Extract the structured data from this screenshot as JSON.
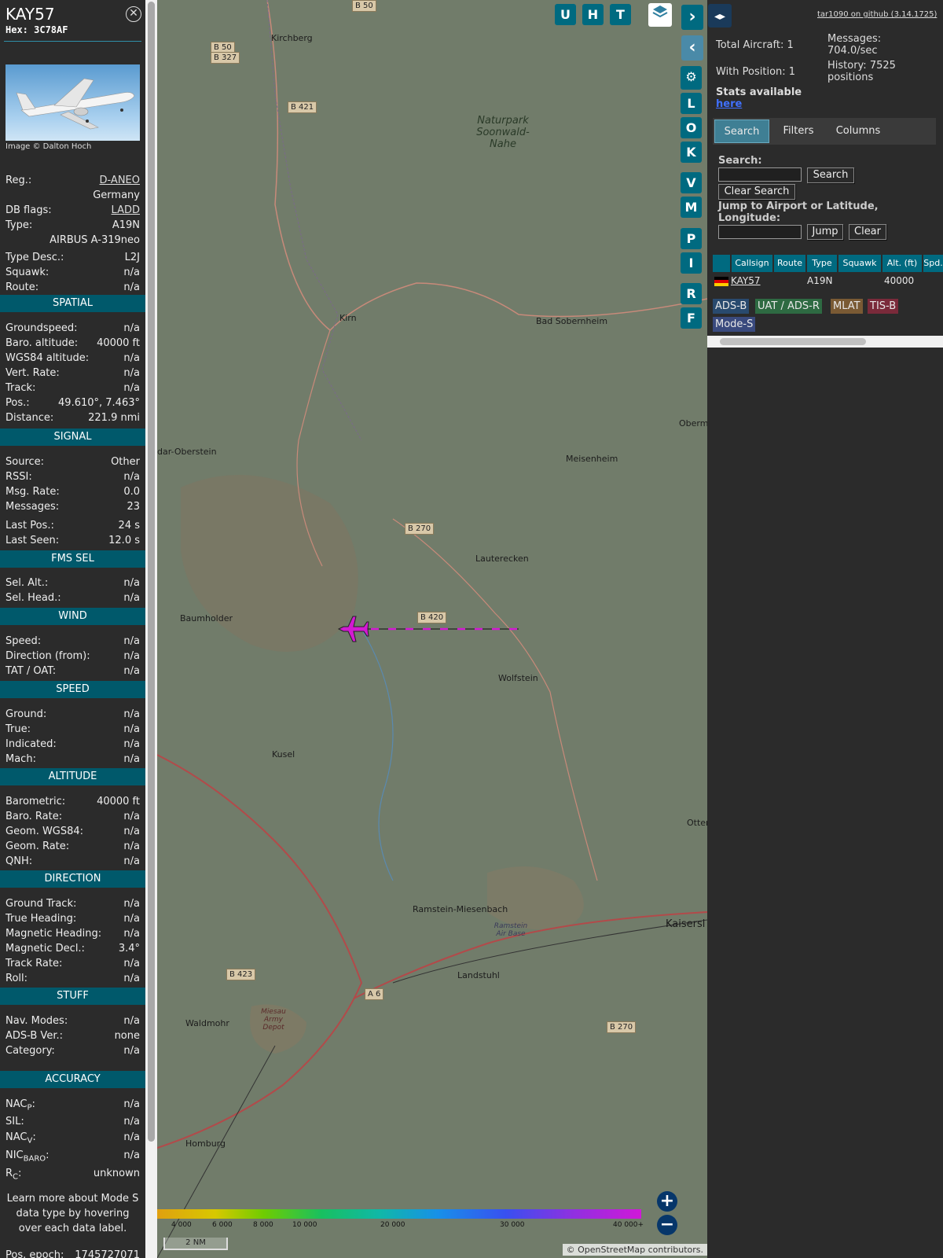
{
  "header": {
    "callsign": "KAY57",
    "hex": "Hex: 3C78AF",
    "photo_credit": "Image © Dalton Hoch"
  },
  "aircraft": [
    {
      "label": "Reg.:",
      "value": "D-ANEO",
      "link": true
    },
    {
      "label": "",
      "value": "Germany"
    },
    {
      "label": "DB flags:",
      "value": "LADD",
      "link": true
    },
    {
      "label": "Type:",
      "value": "A19N"
    },
    {
      "label": "",
      "value": "AIRBUS A-319neo"
    },
    {
      "label": "Type Desc.:",
      "value": "L2J"
    },
    {
      "label": "Squawk:",
      "value": "n/a"
    },
    {
      "label": "Route:",
      "value": "n/a"
    }
  ],
  "sections": {
    "spatial": "SPATIAL",
    "signal": "SIGNAL",
    "fms": "FMS SEL",
    "wind": "WIND",
    "speed": "SPEED",
    "altitude": "ALTITUDE",
    "direction": "DIRECTION",
    "stuff": "STUFF",
    "accuracy": "ACCURACY"
  },
  "spatial": [
    {
      "label": "Groundspeed:",
      "value": "n/a"
    },
    {
      "label": "Baro. altitude:",
      "value": "40000 ft"
    },
    {
      "label": "WGS84 altitude:",
      "value": "n/a"
    },
    {
      "label": "Vert. Rate:",
      "value": "n/a"
    },
    {
      "label": "Track:",
      "value": "n/a"
    },
    {
      "label": "Pos.:",
      "value": "49.610°, 7.463°"
    },
    {
      "label": "Distance:",
      "value": "221.9 nmi"
    }
  ],
  "signal": [
    {
      "label": "Source:",
      "value": "Other"
    },
    {
      "label": "RSSI:",
      "value": "n/a"
    },
    {
      "label": "Msg. Rate:",
      "value": "0.0"
    },
    {
      "label": "Messages:",
      "value": "23"
    },
    {
      "label": "Last Pos.:",
      "value": "24 s"
    },
    {
      "label": "Last Seen:",
      "value": "12.0 s"
    }
  ],
  "fms": [
    {
      "label": "Sel. Alt.:",
      "value": "n/a"
    },
    {
      "label": "Sel. Head.:",
      "value": "n/a"
    }
  ],
  "wind": [
    {
      "label": "Speed:",
      "value": "n/a"
    },
    {
      "label": "Direction (from):",
      "value": "n/a"
    },
    {
      "label": "TAT / OAT:",
      "value": "n/a"
    }
  ],
  "speed": [
    {
      "label": "Ground:",
      "value": "n/a"
    },
    {
      "label": "True:",
      "value": "n/a"
    },
    {
      "label": "Indicated:",
      "value": "n/a"
    },
    {
      "label": "Mach:",
      "value": "n/a"
    }
  ],
  "altitude": [
    {
      "label": "Barometric:",
      "value": "40000 ft"
    },
    {
      "label": "Baro. Rate:",
      "value": "n/a"
    },
    {
      "label": "Geom. WGS84:",
      "value": "n/a"
    },
    {
      "label": "Geom. Rate:",
      "value": "n/a"
    },
    {
      "label": "QNH:",
      "value": "n/a"
    }
  ],
  "direction": [
    {
      "label": "Ground Track:",
      "value": "n/a"
    },
    {
      "label": "True Heading:",
      "value": "n/a"
    },
    {
      "label": "Magnetic Heading:",
      "value": "n/a"
    },
    {
      "label": "Magnetic Decl.:",
      "value": "3.4°"
    },
    {
      "label": "Track Rate:",
      "value": "n/a"
    },
    {
      "label": "Roll:",
      "value": "n/a"
    }
  ],
  "stuff": [
    {
      "label": "Nav. Modes:",
      "value": "n/a"
    },
    {
      "label": "ADS-B Ver.:",
      "value": "none"
    },
    {
      "label": "Category:",
      "value": "n/a"
    }
  ],
  "accuracy": [
    {
      "label": "NAC",
      "sub": "P",
      "value": "n/a"
    },
    {
      "label": "SIL:",
      "sub": "",
      "value": "n/a"
    },
    {
      "label": "NAC",
      "sub": "V",
      "value": "n/a"
    },
    {
      "label": "NIC",
      "sub": "BARO",
      "value": "n/a"
    },
    {
      "label": "R",
      "sub": "C",
      "value": "unknown"
    }
  ],
  "note": "Learn more about Mode S data type by hovering over each data label.",
  "pos_epoch": {
    "label": "Pos. epoch:",
    "value": "1745727071"
  },
  "map": {
    "toolbar_top": [
      "U",
      "H",
      "T"
    ],
    "toolbar_side": [
      "L",
      "O",
      "K",
      "V",
      "M",
      "P",
      "I",
      "R",
      "F"
    ],
    "places": [
      "Kirchberg",
      "Kirn",
      "Bad Sobernheim",
      "dar-Oberstein",
      "Meisenheim",
      "Oberm",
      "Lauterecken",
      "Baumholder",
      "Wolfstein",
      "Kusel",
      "Otter",
      "Ramstein-Miesenbach",
      "Kaisersl",
      "Landstuhl",
      "Waldmohr",
      "Homburg"
    ],
    "park": "Naturpark Soonwald-Nahe",
    "airbase": "Ramstein Air Base",
    "depot": "Miesau Army Depot",
    "roads": [
      "B 50",
      "B 50",
      "B 327",
      "B 421",
      "B 270",
      "B 420",
      "A 6",
      "B 423",
      "B 270"
    ],
    "color_ticks": [
      "4 000",
      "6 000",
      "8 000",
      "10 000",
      "20 000",
      "30 000",
      "40 000+"
    ],
    "scale": "2 NM",
    "attribution": "© OpenStreetMap contributors."
  },
  "right": {
    "github": "tar1090 on github (3.14.1725)",
    "total_aircraft": "Total Aircraft: 1",
    "with_position": "With Position: 1",
    "messages_label": "Messages:",
    "messages_value": "704.0/sec",
    "history_label": "History: 7525",
    "history_value": "positions",
    "stats": "Stats available",
    "stats_link": "here",
    "tabs": [
      "Search",
      "Filters",
      "Columns"
    ],
    "search_label": "Search:",
    "search_btn": "Search",
    "clear_search": "Clear Search",
    "jump_label": "Jump to Airport or Latitude, Longitude:",
    "jump_btn": "Jump",
    "clear_btn": "Clear",
    "columns": [
      "Callsign",
      "Route",
      "Type",
      "Squawk",
      "Alt. (ft)",
      "Spd."
    ],
    "row": {
      "callsign": "KAY57",
      "route": "",
      "type": "A19N",
      "squawk": "",
      "alt": "40000"
    },
    "badges": [
      "ADS-B",
      "UAT / ADS-R",
      "MLAT",
      "TIS-B",
      "Mode-S"
    ]
  },
  "colors": {
    "accent": "#006a80",
    "aircraft": "#d21ad2",
    "badge_adsb": "#294a6e",
    "badge_uat": "#2e6a42",
    "badge_mlat": "#7a5a34",
    "badge_tisb": "#7a2a3a",
    "badge_modes": "#3a4a7e"
  }
}
